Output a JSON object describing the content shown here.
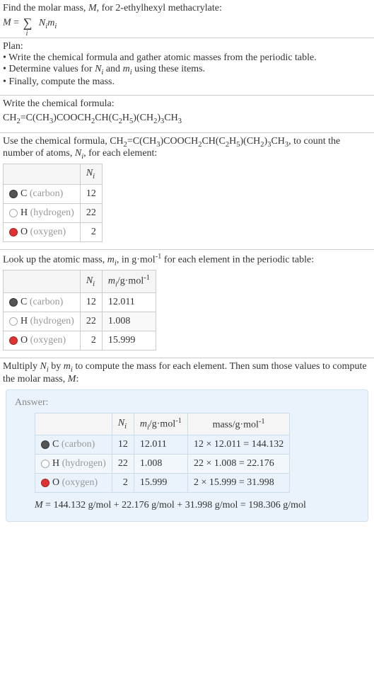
{
  "intro": {
    "line1_pre": "Find the molar mass, ",
    "line1_var": "M",
    "line1_post": ", for 2-ethylhexyl methacrylate:",
    "eq_lhs": "M",
    "eq_rhs_N": "N",
    "eq_rhs_m": "m",
    "eq_idx": "i"
  },
  "plan": {
    "header": "Plan:",
    "b1": "• Write the chemical formula and gather atomic masses from the periodic table.",
    "b2_pre": "• Determine values for ",
    "b2_mid": " and ",
    "b2_post": " using these items.",
    "b3": "• Finally, compute the mass."
  },
  "write_formula": {
    "header": "Write the chemical formula:",
    "f_p1": "CH",
    "f_s1": "2",
    "f_p2": "=C(CH",
    "f_s2": "3",
    "f_p3": ")COOCH",
    "f_s3": "2",
    "f_p4": "CH(C",
    "f_s4": "2",
    "f_p5": "H",
    "f_s5": "5",
    "f_p6": ")(CH",
    "f_s6": "2",
    "f_p7": ")",
    "f_s7": "3",
    "f_p8": "CH",
    "f_s8": "3"
  },
  "count": {
    "pre": "Use the chemical formula, ",
    "post_pre": ", to count the number of atoms, ",
    "post_post": ", for each element:"
  },
  "elements": {
    "c_sym": "C",
    "c_name": " (carbon)",
    "h_sym": "H",
    "h_name": " (hydrogen)",
    "o_sym": "O",
    "o_name": " (oxygen)",
    "Ni_c": "12",
    "Ni_h": "22",
    "Ni_o": "2",
    "mi_c": "12.011",
    "mi_h": "1.008",
    "mi_o": "15.999",
    "mass_c": "12 × 12.011 = 144.132",
    "mass_h": "22 × 1.008 = 22.176",
    "mass_o": "2 × 15.999 = 31.998"
  },
  "headers": {
    "Ni_N": "N",
    "Ni_i": "i",
    "mi_m": "m",
    "mi_i": "i",
    "mi_unit": "/g·mol",
    "mi_exp": "-1",
    "mass": "mass/g·mol",
    "mass_exp": "-1"
  },
  "lookup": {
    "pre": "Look up the atomic mass, ",
    "mid": ", in g·mol",
    "exp": "-1",
    "post": " for each element in the periodic table:"
  },
  "multiply": {
    "p1": "Multiply ",
    "p2": " by ",
    "p3": " to compute the mass for each element. Then sum those values to compute the molar mass, ",
    "p4": ":"
  },
  "answer": {
    "label": "Answer:",
    "final": " = 144.132 g/mol + 22.176 g/mol + 31.998 g/mol = 198.306 g/mol"
  }
}
